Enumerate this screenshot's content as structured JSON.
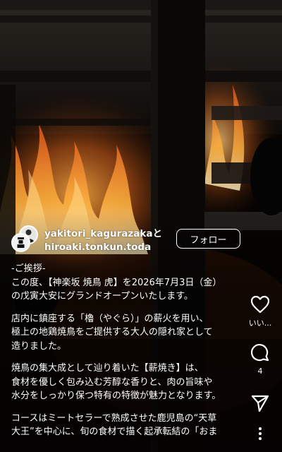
{
  "post": {
    "authors": "yakitori_kagurazakaと\nhiroaki.tonkun.toda",
    "follow_label": "フォロー"
  },
  "caption": {
    "paragraphs": [
      "-ご挨拶-\nこの度、【神楽坂 焼鳥 虎】を2026年7月3日（金）\nの戊寅大安にグランドオープンいたします。",
      "店内に鎮座する「櫓（やぐら）」の薪火を用い、\n極上の地鶏焼鳥をご提供する大人の隠れ家として\n造りました。",
      "焼鳥の集大成として辿り着いた【薪焼き】は、\n食材を優しく包み込む芳醇な香りと、肉の旨味や\n水分をしっかり保つ特有の特徴が魅力となります。",
      "コースはミートセラーで熟成させた鹿児島の“天草\n大王”を中心に、旬の食材で描く起承転結の「おま"
    ]
  },
  "actions": {
    "like": {
      "icon": "heart-icon",
      "label": "いい..."
    },
    "comment": {
      "icon": "comment-icon",
      "label": "4"
    },
    "share": {
      "icon": "send-icon"
    },
    "more": {
      "icon": "more-vertical-icon"
    }
  },
  "colors": {
    "fire": "#f39a2a",
    "text": "#ffffff",
    "background": "#050403"
  }
}
